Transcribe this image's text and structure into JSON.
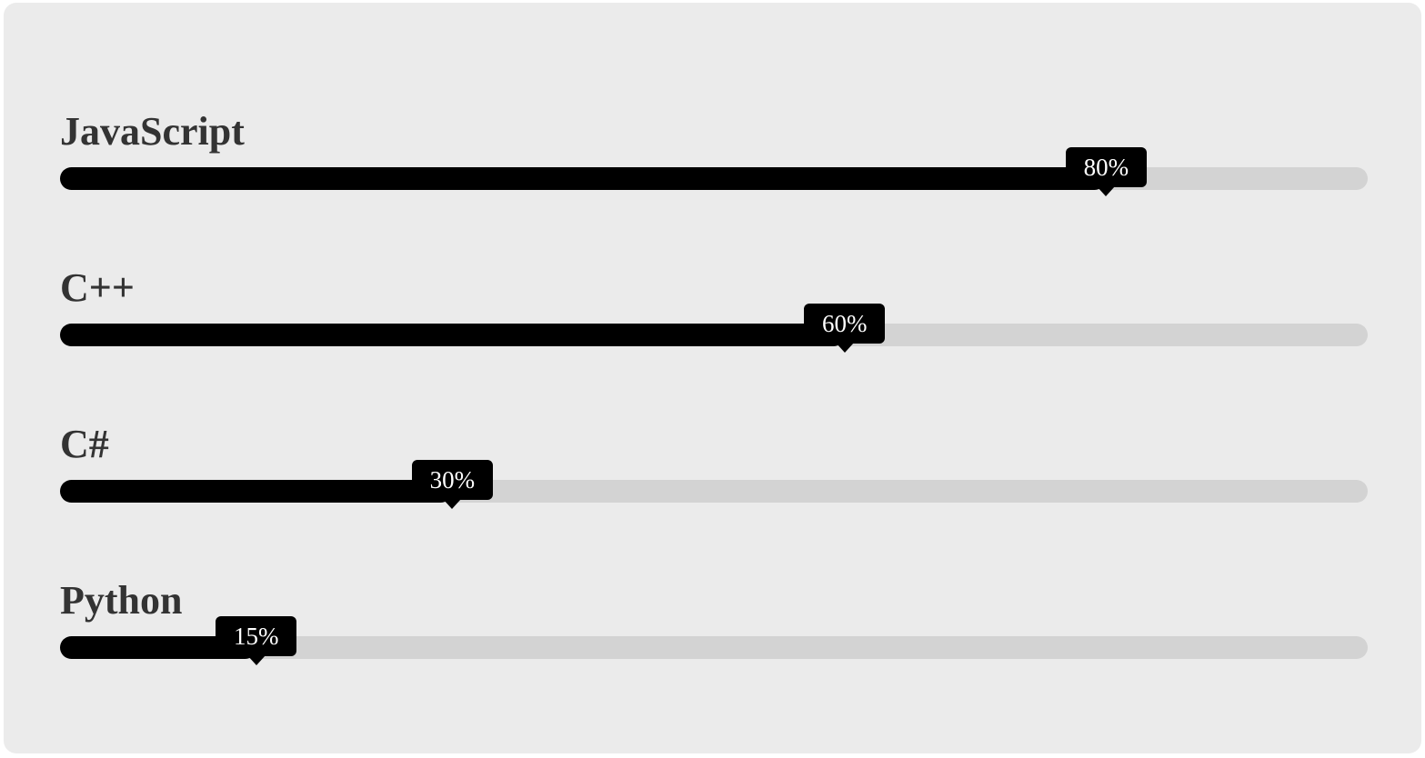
{
  "skills": [
    {
      "name": "JavaScript",
      "percent": 80,
      "label": "80%"
    },
    {
      "name": "C++",
      "percent": 60,
      "label": "60%"
    },
    {
      "name": "C#",
      "percent": 30,
      "label": "30%"
    },
    {
      "name": "Python",
      "percent": 15,
      "label": "15%"
    }
  ],
  "colors": {
    "card_background": "#ebebeb",
    "track": "#d3d3d3",
    "fill": "#000000",
    "label_text": "#333333",
    "tooltip_background": "#000000",
    "tooltip_text": "#ffffff"
  }
}
